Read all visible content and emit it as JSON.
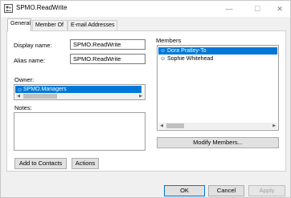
{
  "window": {
    "title": "SPMO.ReadWrite",
    "minimize": "—",
    "maximize": "☐",
    "close": "✕"
  },
  "tabs": [
    {
      "label": "General",
      "active": true
    },
    {
      "label": "Member Of",
      "active": false
    },
    {
      "label": "E-mail Addresses",
      "active": false
    }
  ],
  "general": {
    "display_name_label": "Display name:",
    "display_name_value": "SPMO.ReadWrite",
    "alias_name_label": "Alias name:",
    "alias_name_value": "SPMO.ReadWrite",
    "owner_label": "Owner:",
    "owner_items": [
      "SPMO.Managers"
    ],
    "notes_label": "Notes:",
    "notes_value": "",
    "members_label": "Members",
    "members": [
      {
        "name": "Dora Pratley-To",
        "selected": true
      },
      {
        "name": "Sophie Whitehead",
        "selected": false
      }
    ],
    "modify_members_label": "Modify Members...",
    "add_to_contacts_label": "Add to Contacts",
    "actions_label": "Actions"
  },
  "footer": {
    "ok_label": "OK",
    "cancel_label": "Cancel",
    "apply_label": "Apply"
  },
  "colors": {
    "selection": "#0078d7",
    "window_bg": "#f0f0f0",
    "panel_bg": "#ffffff"
  },
  "icons": {
    "app": "contact-group-icon",
    "person": "person-icon"
  }
}
